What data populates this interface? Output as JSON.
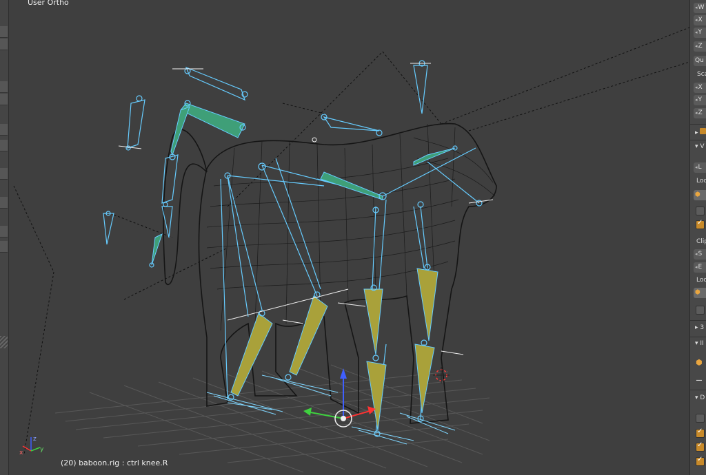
{
  "viewport": {
    "title": "User Ortho",
    "status": "(20) baboon.rig : ctrl knee.R"
  },
  "properties": {
    "transform_fields": [
      "W",
      "X",
      "Y",
      "Z"
    ],
    "rotation_mode": "Qu",
    "scale_label": "Sca",
    "scale_fields": [
      "X",
      "Y",
      "Z"
    ],
    "layers_label": "L",
    "local_label": "Loc",
    "clip_label": "Clip",
    "clip_fields": [
      "S",
      "E"
    ],
    "local_label_2": "Loc",
    "panel_toggle_1": "3",
    "panel_toggle_2": "II",
    "panel_toggle_3": "D"
  },
  "colors": {
    "bone_blue": "#66ccff",
    "bone_green": "#3f9f78",
    "bone_yellow": "#a9a13a",
    "mesh": "#141414",
    "grid": "#5a5a5a"
  }
}
